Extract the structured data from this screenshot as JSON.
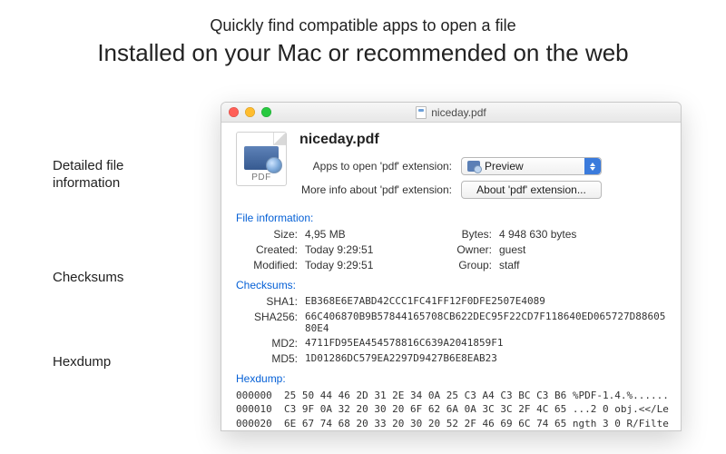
{
  "hero": {
    "line1": "Quickly find compatible apps to open a file",
    "line2": "Installed on your Mac or recommended on the web"
  },
  "callouts": {
    "detailed_l1": "Detailed file",
    "detailed_l2": "information",
    "checksums": "Checksums",
    "hexdump": "Hexdump"
  },
  "window": {
    "title": "niceday.pdf",
    "filename": "niceday.pdf",
    "file_ext_label": "PDF",
    "apps_label": "Apps to open 'pdf' extension:",
    "apps_value": "Preview",
    "moreinfo_label": "More info about 'pdf' extension:",
    "moreinfo_button": "About 'pdf' extension..."
  },
  "sections": {
    "fileinfo": "File information:",
    "checksums": "Checksums:",
    "hexdump": "Hexdump:"
  },
  "fileinfo": {
    "size_k": "Size:",
    "size_v": "4,95 MB",
    "bytes_k": "Bytes:",
    "bytes_v": "4 948 630 bytes",
    "created_k": "Created:",
    "created_v": "Today 9:29:51",
    "owner_k": "Owner:",
    "owner_v": "guest",
    "modified_k": "Modified:",
    "modified_v": "Today 9:29:51",
    "group_k": "Group:",
    "group_v": "staff"
  },
  "checksums": {
    "sha1_k": "SHA1:",
    "sha1_v": "EB368E6E7ABD42CCC1FC41FF12F0DFE2507E4089",
    "sha256_k": "SHA256:",
    "sha256_v": "66C406870B9B57844165708CB622DEC95F22CD7F118640ED065727D8860580E4",
    "md2_k": "MD2:",
    "md2_v": "4711FD95EA454578816C639A2041859F1",
    "md5_k": "MD5:",
    "md5_v": "1D01286DC579EA2297D9427B6E8EAB23"
  },
  "hex": {
    "l1": "000000  25 50 44 46 2D 31 2E 34 0A 25 C3 A4 C3 BC C3 B6 %PDF-1.4.%......",
    "l2": "000010  C3 9F 0A 32 20 30 20 6F 62 6A 0A 3C 3C 2F 4C 65 ...2 0 obj.<</Le",
    "l3": "000020  6E 67 74 68 20 33 20 30 20 52 2F 46 69 6C 74 65 ngth 3 0 R/Filte"
  }
}
